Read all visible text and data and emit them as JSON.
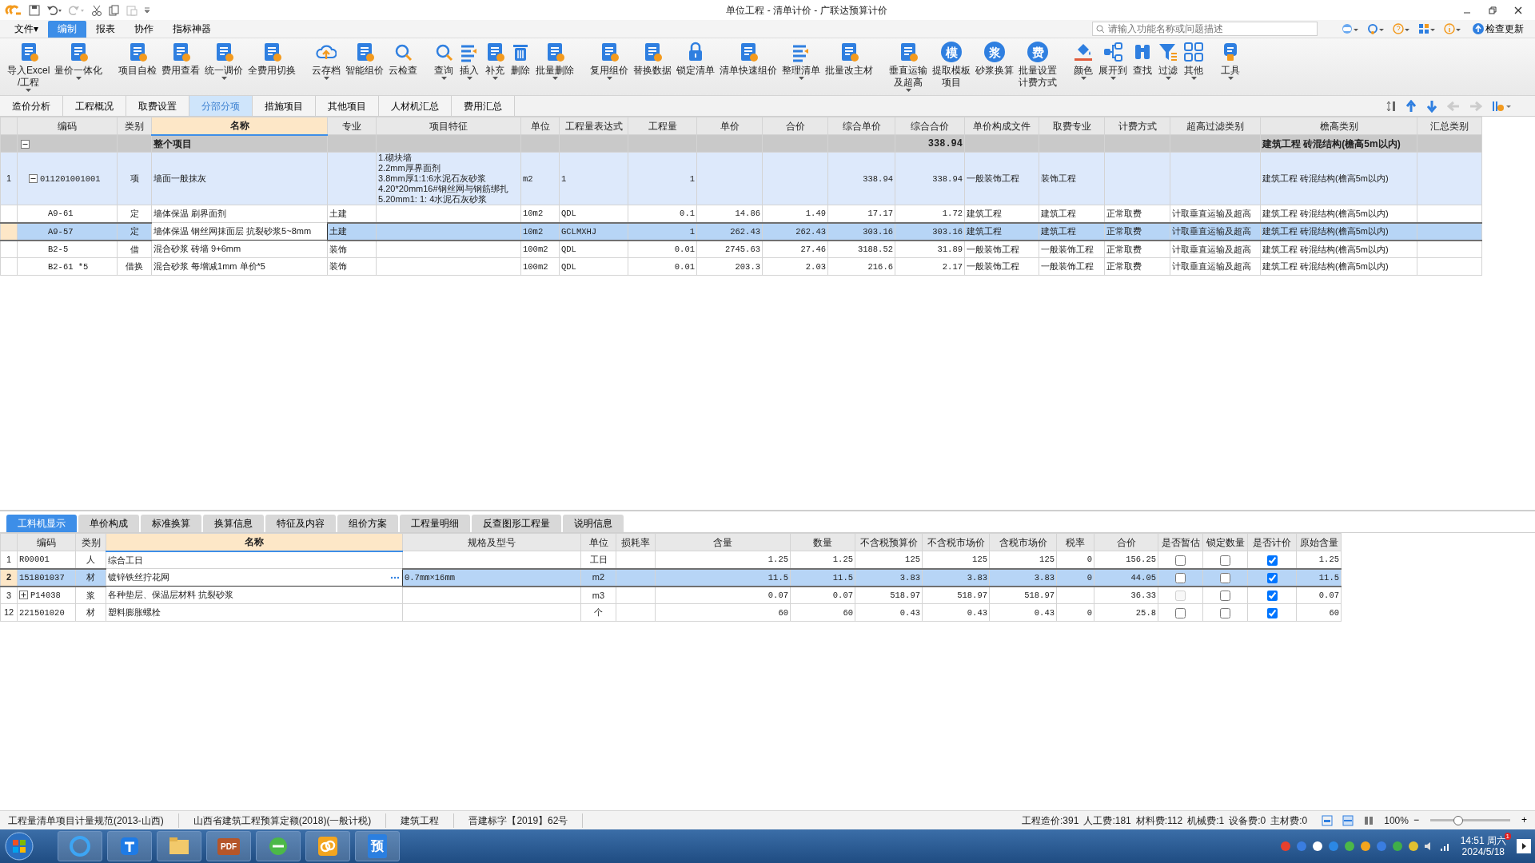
{
  "window": {
    "title": "单位工程 - 清单计价 - 广联达预算计价"
  },
  "menu": [
    {
      "label": "文件▾",
      "selected": false
    },
    {
      "label": "编制",
      "selected": true
    },
    {
      "label": "报表",
      "selected": false
    },
    {
      "label": "协作",
      "selected": false
    },
    {
      "label": "指标神器",
      "selected": false
    }
  ],
  "search": {
    "placeholder": "请输入功能名称或问题描述"
  },
  "update_button": "检查更新",
  "ribbon": [
    {
      "lines": [
        "导入Excel",
        "/工程"
      ],
      "dropdown": true
    },
    {
      "lines": [
        "量价一体化"
      ],
      "dropdown": true
    },
    {
      "lines": [
        "项目自检"
      ],
      "dropdown": false
    },
    {
      "lines": [
        "费用查看"
      ],
      "dropdown": false
    },
    {
      "lines": [
        "统一调价"
      ],
      "dropdown": true
    },
    {
      "lines": [
        "全费用切换"
      ],
      "dropdown": false
    },
    {
      "lines": [
        "云存档"
      ],
      "dropdown": true
    },
    {
      "lines": [
        "智能组价"
      ],
      "dropdown": false
    },
    {
      "lines": [
        "云检查"
      ],
      "dropdown": false
    },
    {
      "lines": [
        "查询"
      ],
      "dropdown": true
    },
    {
      "lines": [
        "插入"
      ],
      "dropdown": true
    },
    {
      "lines": [
        "补充"
      ],
      "dropdown": true
    },
    {
      "lines": [
        "删除"
      ],
      "dropdown": false
    },
    {
      "lines": [
        "批量删除"
      ],
      "dropdown": true
    },
    {
      "lines": [
        "复用组价"
      ],
      "dropdown": true
    },
    {
      "lines": [
        "替换数据"
      ],
      "dropdown": false
    },
    {
      "lines": [
        "锁定清单"
      ],
      "dropdown": false
    },
    {
      "lines": [
        "清单快速组价"
      ],
      "dropdown": false
    },
    {
      "lines": [
        "整理清单"
      ],
      "dropdown": true
    },
    {
      "lines": [
        "批量改主材"
      ],
      "dropdown": false
    },
    {
      "lines": [
        "垂直运输",
        "及超高"
      ],
      "dropdown": true
    },
    {
      "lines": [
        "提取模板",
        "项目"
      ],
      "dropdown": false,
      "glyph": "模"
    },
    {
      "lines": [
        "砂浆换算"
      ],
      "dropdown": false,
      "glyph": "浆"
    },
    {
      "lines": [
        "批量设置",
        "计费方式"
      ],
      "dropdown": false,
      "glyph": "费"
    },
    {
      "lines": [
        "颜色"
      ],
      "dropdown": true
    },
    {
      "lines": [
        "展开到"
      ],
      "dropdown": true
    },
    {
      "lines": [
        "查找"
      ],
      "dropdown": false
    },
    {
      "lines": [
        "过滤"
      ],
      "dropdown": true
    },
    {
      "lines": [
        "其他"
      ],
      "dropdown": true
    },
    {
      "lines": [
        "工具"
      ],
      "dropdown": true
    }
  ],
  "tabs": [
    {
      "label": "造价分析",
      "selected": false
    },
    {
      "label": "工程概况",
      "selected": false
    },
    {
      "label": "取费设置",
      "selected": false
    },
    {
      "label": "分部分项",
      "selected": true
    },
    {
      "label": "措施项目",
      "selected": false
    },
    {
      "label": "其他项目",
      "selected": false
    },
    {
      "label": "人材机汇总",
      "selected": false
    },
    {
      "label": "费用汇总",
      "selected": false
    }
  ],
  "table": {
    "columns": [
      "编码",
      "类别",
      "名称",
      "专业",
      "项目特征",
      "单位",
      "工程量表达式",
      "工程量",
      "单价",
      "合价",
      "综合单价",
      "综合合价",
      "单价构成文件",
      "取费专业",
      "计费方式",
      "超高过滤类别",
      "檐高类别",
      "汇总类别"
    ],
    "rows": [
      {
        "kind": "group",
        "no": "",
        "expanded": true,
        "selected": false,
        "cells": [
          "",
          "",
          "整个项目",
          "",
          "",
          "",
          "",
          "",
          "",
          "",
          "",
          "338.94",
          "",
          "",
          "",
          "",
          "建筑工程 砖混结构(檐高5m以内)",
          ""
        ]
      },
      {
        "kind": "item",
        "no": "1",
        "expanded": true,
        "selected": false,
        "cells": [
          "011201001001",
          "项",
          "墙面一般抹灰",
          "",
          [
            "1.砌块墙",
            "2.2mm厚界面剂",
            "3.8mm厚1:1:6水泥石灰砂浆",
            "4.20*20mm16#钢丝网与钢筋绑扎",
            "5.20mm1: 1: 4水泥石灰砂浆"
          ],
          "m2",
          "1",
          "1",
          "",
          "",
          "338.94",
          "338.94",
          "一般装饰工程",
          "装饰工程",
          "",
          "",
          "建筑工程 砖混结构(檐高5m以内)",
          ""
        ]
      },
      {
        "kind": "sub",
        "no": "",
        "selected": false,
        "cells": [
          "A9-61",
          "定",
          "墙体保温 刷界面剂",
          "土建",
          "",
          "10m2",
          "QDL",
          "0.1",
          "14.86",
          "1.49",
          "17.17",
          "1.72",
          "建筑工程",
          "建筑工程",
          "正常取费",
          "计取垂直运输及超高",
          "建筑工程 砖混结构(檐高5m以内)",
          ""
        ]
      },
      {
        "kind": "sub",
        "no": "",
        "selected": true,
        "cells": [
          "A9-57",
          "定",
          "墙体保温 钢丝网抹面层 抗裂砂浆5~8mm",
          "土建",
          "",
          "10m2",
          "GCLMXHJ",
          "1",
          "262.43",
          "262.43",
          "303.16",
          "303.16",
          "建筑工程",
          "建筑工程",
          "正常取费",
          "计取垂直运输及超高",
          "建筑工程 砖混结构(檐高5m以内)",
          ""
        ]
      },
      {
        "kind": "sub",
        "no": "",
        "selected": false,
        "cells": [
          "B2-5",
          "借",
          "混合砂浆 砖墙 9+6mm",
          "装饰",
          "",
          "100m2",
          "QDL",
          "0.01",
          "2745.63",
          "27.46",
          "3188.52",
          "31.89",
          "一般装饰工程",
          "一般装饰工程",
          "正常取费",
          "计取垂直运输及超高",
          "建筑工程 砖混结构(檐高5m以内)",
          ""
        ]
      },
      {
        "kind": "sub",
        "no": "",
        "selected": false,
        "cells": [
          "B2-61 *5",
          "借换",
          "混合砂浆 每增减1mm  单价*5",
          "装饰",
          "",
          "100m2",
          "QDL",
          "0.01",
          "203.3",
          "2.03",
          "216.6",
          "2.17",
          "一般装饰工程",
          "一般装饰工程",
          "正常取费",
          "计取垂直运输及超高",
          "建筑工程 砖混结构(檐高5m以内)",
          ""
        ]
      }
    ]
  },
  "detail_tabs": [
    {
      "label": "工料机显示",
      "selected": true
    },
    {
      "label": "单价构成",
      "selected": false
    },
    {
      "label": "标准换算",
      "selected": false
    },
    {
      "label": "换算信息",
      "selected": false
    },
    {
      "label": "特征及内容",
      "selected": false
    },
    {
      "label": "组价方案",
      "selected": false
    },
    {
      "label": "工程量明细",
      "selected": false
    },
    {
      "label": "反查图形工程量",
      "selected": false
    },
    {
      "label": "说明信息",
      "selected": false
    }
  ],
  "detail_table": {
    "columns": [
      "编码",
      "类别",
      "名称",
      "规格及型号",
      "单位",
      "损耗率",
      "含量",
      "数量",
      "不含税预算价",
      "不含税市场价",
      "含税市场价",
      "税率",
      "合价",
      "是否暂估",
      "锁定数量",
      "是否计价",
      "原始含量"
    ],
    "rows": [
      {
        "no": "1",
        "selected": false,
        "cells": [
          "R00001",
          "人",
          "综合工日",
          "",
          "工日",
          "",
          "1.25",
          "1.25",
          "125",
          "125",
          "125",
          "0",
          "156.25",
          {
            "checked": false,
            "disabled": false
          },
          {
            "checked": false,
            "disabled": false
          },
          {
            "checked": true,
            "disabled": false
          },
          "1.25"
        ]
      },
      {
        "no": "2",
        "selected": true,
        "cells": [
          "151801037",
          "材",
          "镀锌铁丝拧花网",
          "0.7mm×16mm",
          "m2",
          "",
          "11.5",
          "11.5",
          "3.83",
          "3.83",
          "3.83",
          "0",
          "44.05",
          {
            "checked": false,
            "disabled": false
          },
          {
            "checked": false,
            "disabled": false
          },
          {
            "checked": true,
            "disabled": false
          },
          "11.5"
        ]
      },
      {
        "no": "3",
        "selected": false,
        "expanded": false,
        "cells": [
          "P14038",
          "浆",
          "各种垫层、保温层材料 抗裂砂浆",
          "",
          "m3",
          "",
          "0.07",
          "0.07",
          "518.97",
          "518.97",
          "518.97",
          "",
          "36.33",
          {
            "checked": false,
            "disabled": true
          },
          {
            "checked": false,
            "disabled": false
          },
          {
            "checked": true,
            "disabled": false
          },
          "0.07"
        ]
      },
      {
        "no": "12",
        "selected": false,
        "cells": [
          "221501020",
          "材",
          "塑料膨胀螺栓",
          "",
          "个",
          "",
          "60",
          "60",
          "0.43",
          "0.43",
          "0.43",
          "0",
          "25.8",
          {
            "checked": false,
            "disabled": false
          },
          {
            "checked": false,
            "disabled": false
          },
          {
            "checked": true,
            "disabled": false
          },
          "60"
        ]
      }
    ]
  },
  "status_bar": {
    "left": [
      "工程量清单项目计量规范(2013-山西)",
      "山西省建筑工程预算定额(2018)(一般计税)",
      "建筑工程",
      "晋建标字【2019】62号"
    ],
    "right": [
      "工程造价:391",
      "人工费:181",
      "材料费:112",
      "机械费:1",
      "设备费:0",
      "主材费:0"
    ],
    "zoom": "100%",
    "zoom_out": "−",
    "zoom_in": "+",
    "level": 0.35
  },
  "taskbar": {
    "pdf_label": "PDF",
    "app_label": "预",
    "time": "14:51 周六",
    "date": "2024/5/18",
    "badge": "1"
  }
}
